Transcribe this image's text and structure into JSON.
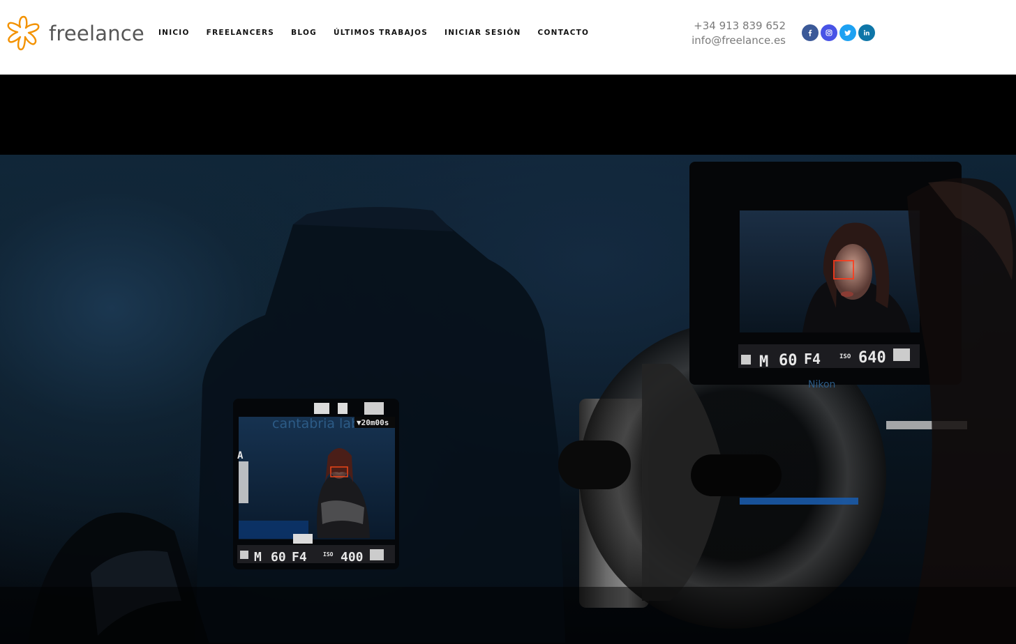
{
  "brand": {
    "name": "freelance",
    "accent": "#f39200"
  },
  "nav": {
    "items": [
      {
        "label": "INICIO"
      },
      {
        "label": "FREELANCERS"
      },
      {
        "label": "BLOG"
      },
      {
        "label": "ÚLTIMOS TRABAJOS"
      },
      {
        "label": "INICIAR SESIÓN"
      },
      {
        "label": "CONTACTO"
      }
    ]
  },
  "contact": {
    "phone": "+34 913 839 652",
    "email": "info@freelance.es"
  },
  "social": [
    {
      "icon": "facebook-icon",
      "color": "#3b5998"
    },
    {
      "icon": "instagram-icon",
      "color": "#4853e6"
    },
    {
      "icon": "twitter-icon",
      "color": "#1da1f2"
    },
    {
      "icon": "linkedin-icon",
      "color": "#0e76a8"
    }
  ],
  "hero": {
    "left_screen": {
      "brand": "cantabria labs",
      "top_readout": "▼20m00s",
      "mode": "M",
      "shutter": "60",
      "aperture": "F4",
      "iso_label": "ISO",
      "iso": "400"
    },
    "right_screen": {
      "mode": "M",
      "shutter": "60",
      "aperture": "F4",
      "iso_label": "ISO",
      "iso": "640",
      "camera_brand": "Nikon"
    }
  }
}
